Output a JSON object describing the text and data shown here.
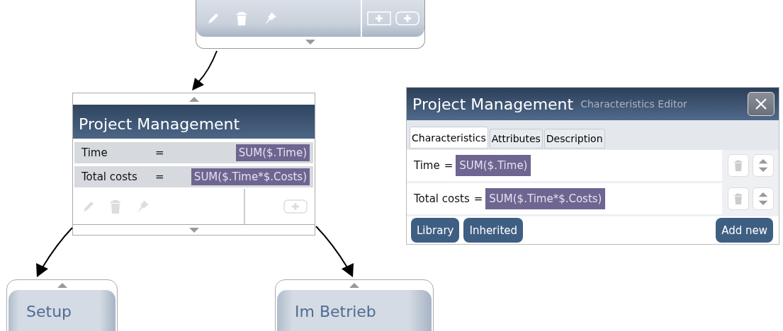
{
  "node": {
    "title": "Project Management",
    "characteristics": [
      {
        "name": "Time",
        "operator": "=",
        "formula": "SUM($.Time)"
      },
      {
        "name": "Total costs",
        "operator": "=",
        "formula": "SUM($.Time*$.Costs)"
      }
    ]
  },
  "child_nodes": [
    {
      "title": "Setup"
    },
    {
      "title": "Im Betrieb"
    }
  ],
  "editor": {
    "title": "Project Management",
    "subtitle": "Characteristics Editor",
    "tabs": [
      {
        "label": "Characteristics",
        "selected": true
      },
      {
        "label": "Attributes",
        "selected": false
      },
      {
        "label": "Description",
        "selected": false
      }
    ],
    "rows": [
      {
        "name": "Time",
        "operator": "=",
        "formula": "SUM($.Time)"
      },
      {
        "name": "Total costs",
        "operator": "=",
        "formula": "SUM($.Time*$.Costs)"
      }
    ],
    "left_buttons": [
      "Library",
      "Inherited"
    ],
    "right_button": "Add new"
  }
}
